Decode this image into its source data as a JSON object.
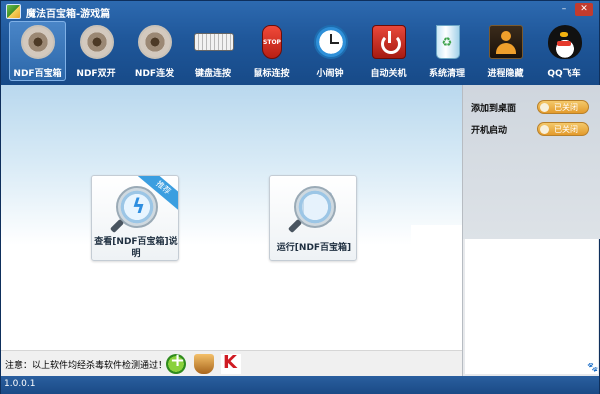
{
  "window": {
    "title": "魔法百宝箱-游戏篇",
    "controls": {
      "minimize": "–",
      "close": "✕"
    }
  },
  "toolbar": {
    "items": [
      {
        "label": "NDF百宝箱",
        "icon": "disc-icon",
        "active": true
      },
      {
        "label": "NDF双开",
        "icon": "disc-icon"
      },
      {
        "label": "NDF连发",
        "icon": "disc-icon"
      },
      {
        "label": "键盘连按",
        "icon": "keyboard-icon"
      },
      {
        "label": "鼠标连按",
        "icon": "mouse-stop-icon",
        "icon_text": "STOP"
      },
      {
        "label": "小闹钟",
        "icon": "alarm-clock-icon"
      },
      {
        "label": "自动关机",
        "icon": "power-icon"
      },
      {
        "label": "系统清理",
        "icon": "recycle-bin-icon"
      },
      {
        "label": "进程隐藏",
        "icon": "user-hidden-icon"
      },
      {
        "label": "QQ飞车",
        "icon": "qq-penguin-icon"
      }
    ]
  },
  "main": {
    "cards": [
      {
        "label": "查看[NDF百宝箱]说明",
        "ribbon": "推荐",
        "icon": "magnifier-lightning-icon"
      },
      {
        "label": "运行[NDF百宝箱]",
        "icon": "magnifier-disk-icon"
      }
    ],
    "notice": "注意：以上软件均经杀毒软件检测通过！",
    "antivirus_icons": [
      "360-icon",
      "jinshan-icon",
      "kaspersky-icon"
    ],
    "paw_glyph": "🐾"
  },
  "settings": {
    "rows": [
      {
        "label": "添加到桌面",
        "toggle": "已关闭"
      },
      {
        "label": "开机启动",
        "toggle": "已关闭"
      }
    ]
  },
  "status": {
    "version": "1.0.0.1"
  },
  "colors": {
    "header": "#1f579a",
    "toggle": "#e8a030",
    "accent": "#3b9ee0"
  }
}
